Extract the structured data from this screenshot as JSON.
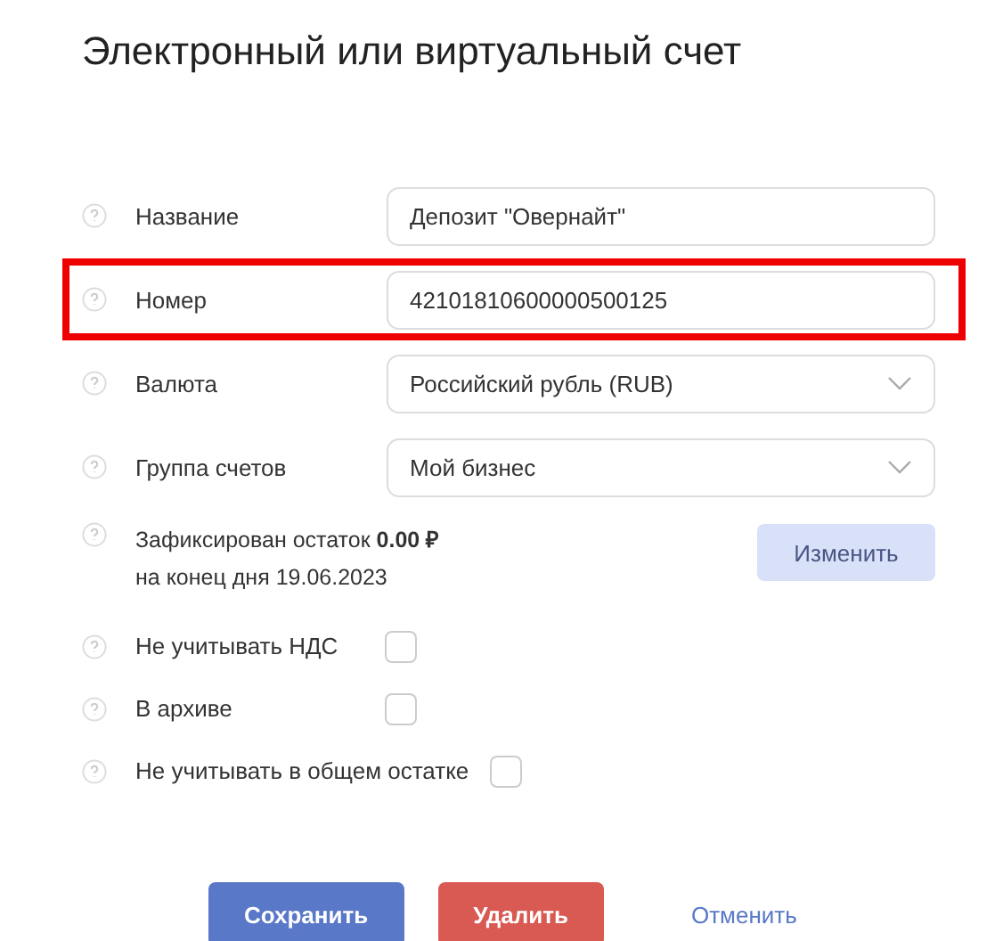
{
  "title": "Электронный или виртуальный счет",
  "fields": [
    {
      "kind": "text",
      "label": "Название",
      "value": "Депозит \"Овернайт\"",
      "highlighted": false
    },
    {
      "kind": "text",
      "label": "Номер",
      "value": "42101810600000500125",
      "highlighted": true
    },
    {
      "kind": "select",
      "label": "Валюта",
      "value": "Российский рубль (RUB)",
      "highlighted": false
    },
    {
      "kind": "select",
      "label": "Группа счетов",
      "value": "Мой бизнес",
      "highlighted": false
    }
  ],
  "balance": {
    "lines": [
      "Зафиксирован остаток **0.00 ₽**",
      "на конец дня 19.06.2023"
    ],
    "button": "Изменить"
  },
  "checkboxes": [
    {
      "label": "Не учитывать НДС",
      "checked": false
    },
    {
      "label": "В архиве",
      "checked": false
    },
    {
      "label": "Не учитывать в общем остатке",
      "checked": false
    }
  ],
  "actions": [
    {
      "kind": "primary",
      "label": "Сохранить"
    },
    {
      "kind": "danger",
      "label": "Удалить"
    },
    {
      "kind": "link",
      "label": "Отменить"
    }
  ]
}
